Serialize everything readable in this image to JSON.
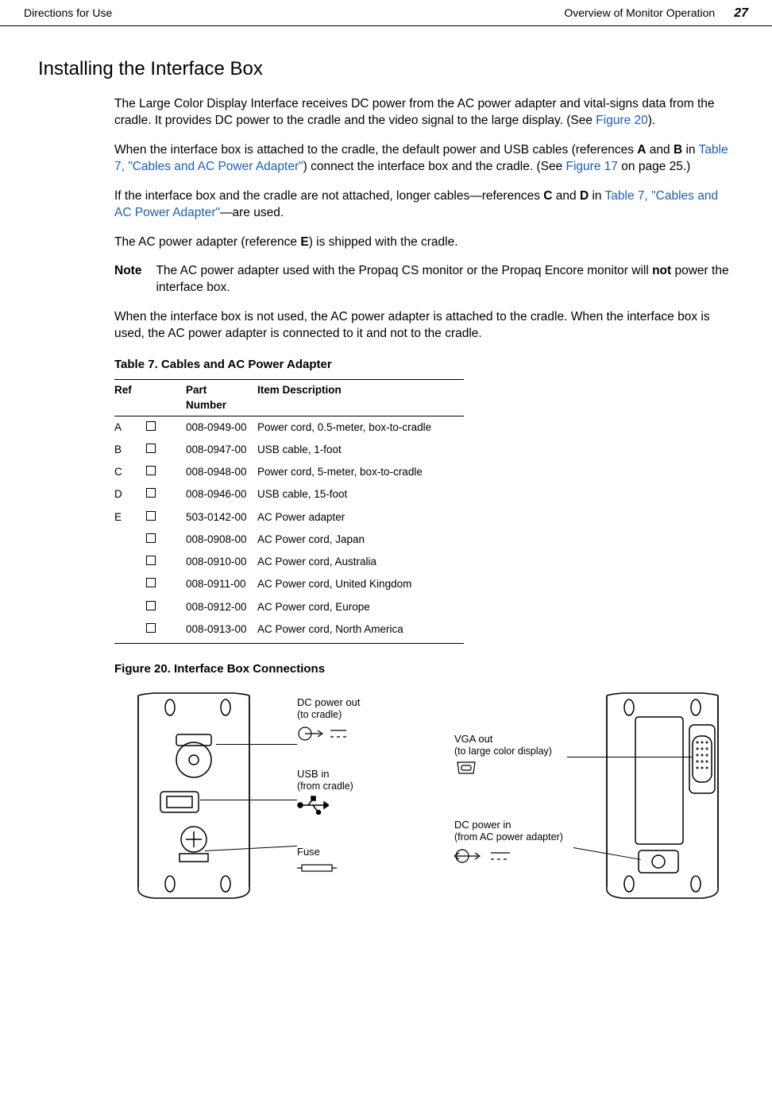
{
  "header": {
    "left": "Directions for Use",
    "right_text": "Overview of Monitor Operation",
    "page": "27"
  },
  "section_title": "Installing the Interface Box",
  "p1_a": "The Large Color Display Interface receives DC power from the AC power adapter and vital-signs data from the cradle. It provides DC power to the cradle and the video signal to the large display. (See ",
  "p1_link": "Figure 20",
  "p1_b": ").",
  "p2_a": "When the interface box is attached to the cradle, the default power and USB cables (references ",
  "p2_boldA": "A",
  "p2_mid1": " and ",
  "p2_boldB": "B",
  "p2_mid2": " in ",
  "p2_link": "Table 7, \"Cables and AC Power Adapter\"",
  "p2_mid3": ") connect the interface box and the cradle. (See ",
  "p2_link2": "Figure 17",
  "p2_tail": " on page 25.)",
  "p3_a": "If the interface box and the cradle are not attached, longer cables—references ",
  "p3_boldC": "C",
  "p3_mid": " and ",
  "p3_boldD": "D",
  "p3_mid2": " in ",
  "p3_link": "Table 7, \"Cables and AC Power Adapter\"",
  "p3_tail": "—are used.",
  "p4_a": "The AC power adapter (reference ",
  "p4_boldE": "E",
  "p4_b": ") is shipped with the cradle.",
  "note_label": "Note",
  "note_a": "The AC power adapter used with the Propaq CS monitor or the Propaq Encore monitor will ",
  "note_bold": "not",
  "note_b": " power the interface box.",
  "p5": "When the interface box is not used, the AC power adapter is attached to the cradle. When the interface box is used, the AC power adapter is connected to it and not to the cradle.",
  "table_caption": "Table 7.  Cables and AC Power Adapter",
  "table_headers": {
    "ref": "Ref",
    "part": "Part Number",
    "desc": "Item Description"
  },
  "table_rows": [
    {
      "ref": "A",
      "part": "008-0949-00",
      "desc": "Power cord, 0.5-meter, box-to-cradle"
    },
    {
      "ref": "B",
      "part": "008-0947-00",
      "desc": "USB cable, 1-foot"
    },
    {
      "ref": "C",
      "part": "008-0948-00",
      "desc": "Power cord, 5-meter, box-to-cradle"
    },
    {
      "ref": "D",
      "part": "008-0946-00",
      "desc": "USB cable, 15-foot"
    },
    {
      "ref": "E",
      "part": "503-0142-00",
      "desc": "AC Power adapter"
    },
    {
      "ref": "",
      "part": "008-0908-00",
      "desc": "AC Power cord, Japan"
    },
    {
      "ref": "",
      "part": "008-0910-00",
      "desc": "AC Power cord, Australia"
    },
    {
      "ref": "",
      "part": "008-0911-00",
      "desc": "AC Power cord, United Kingdom"
    },
    {
      "ref": "",
      "part": "008-0912-00",
      "desc": "AC Power cord, Europe"
    },
    {
      "ref": "",
      "part": "008-0913-00",
      "desc": "AC Power cord, North America"
    }
  ],
  "figure_caption": "Figure 20.  Interface Box Connections",
  "callouts": {
    "dcout": "DC power out",
    "dcout_sub": "(to cradle)",
    "usbin": "USB in",
    "usbin_sub": "(from cradle)",
    "fuse": "Fuse",
    "vgaout": "VGA out",
    "vgaout_sub": "(to large color display)",
    "dcin": "DC power in",
    "dcin_sub": "(from AC power adapter)"
  }
}
